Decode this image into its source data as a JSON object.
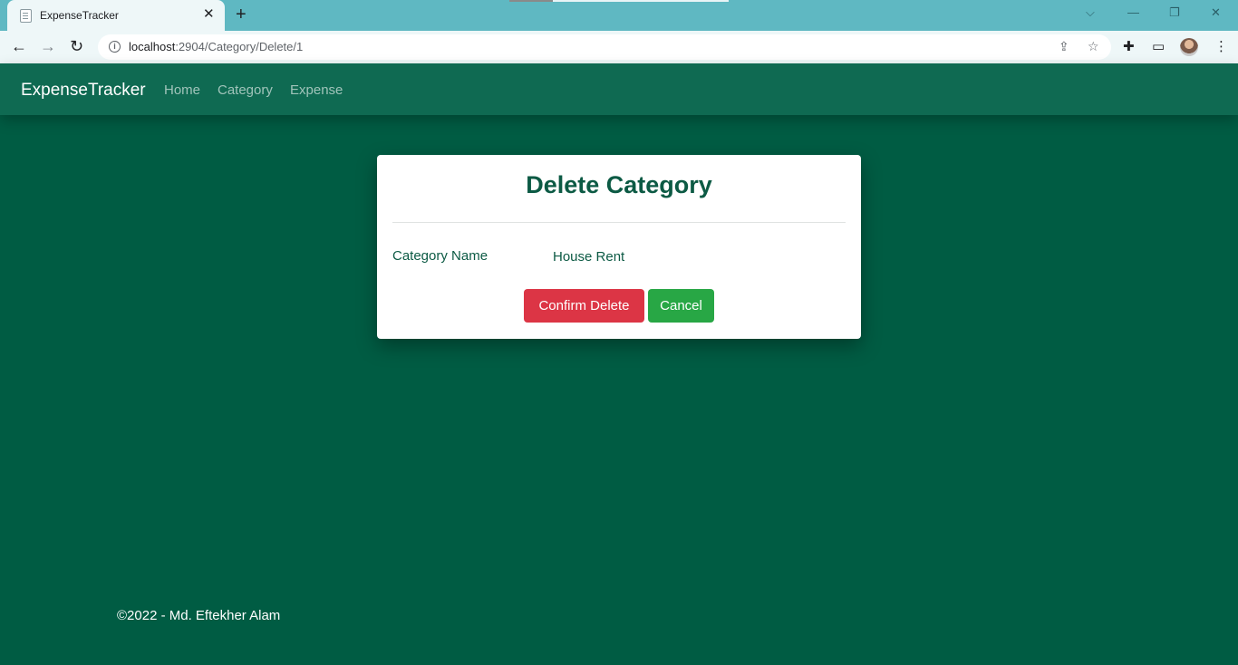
{
  "browser": {
    "tab_title": "ExpenseTracker",
    "url_host": "localhost",
    "url_path": ":2904/Category/Delete/1"
  },
  "navbar": {
    "brand": "ExpenseTracker",
    "links": [
      "Home",
      "Category",
      "Expense"
    ]
  },
  "card": {
    "title": "Delete Category",
    "field_label": "Category Name",
    "field_value": "House Rent",
    "confirm_label": "Confirm Delete",
    "cancel_label": "Cancel"
  },
  "footer": {
    "text": "©2022 - Md. Eftekher Alam"
  },
  "colors": {
    "page_bg": "#005c43",
    "navbar_bg": "#0f6a52",
    "danger": "#dc3545",
    "success": "#28a745",
    "chrome_tabbar": "#5fb8c2"
  }
}
